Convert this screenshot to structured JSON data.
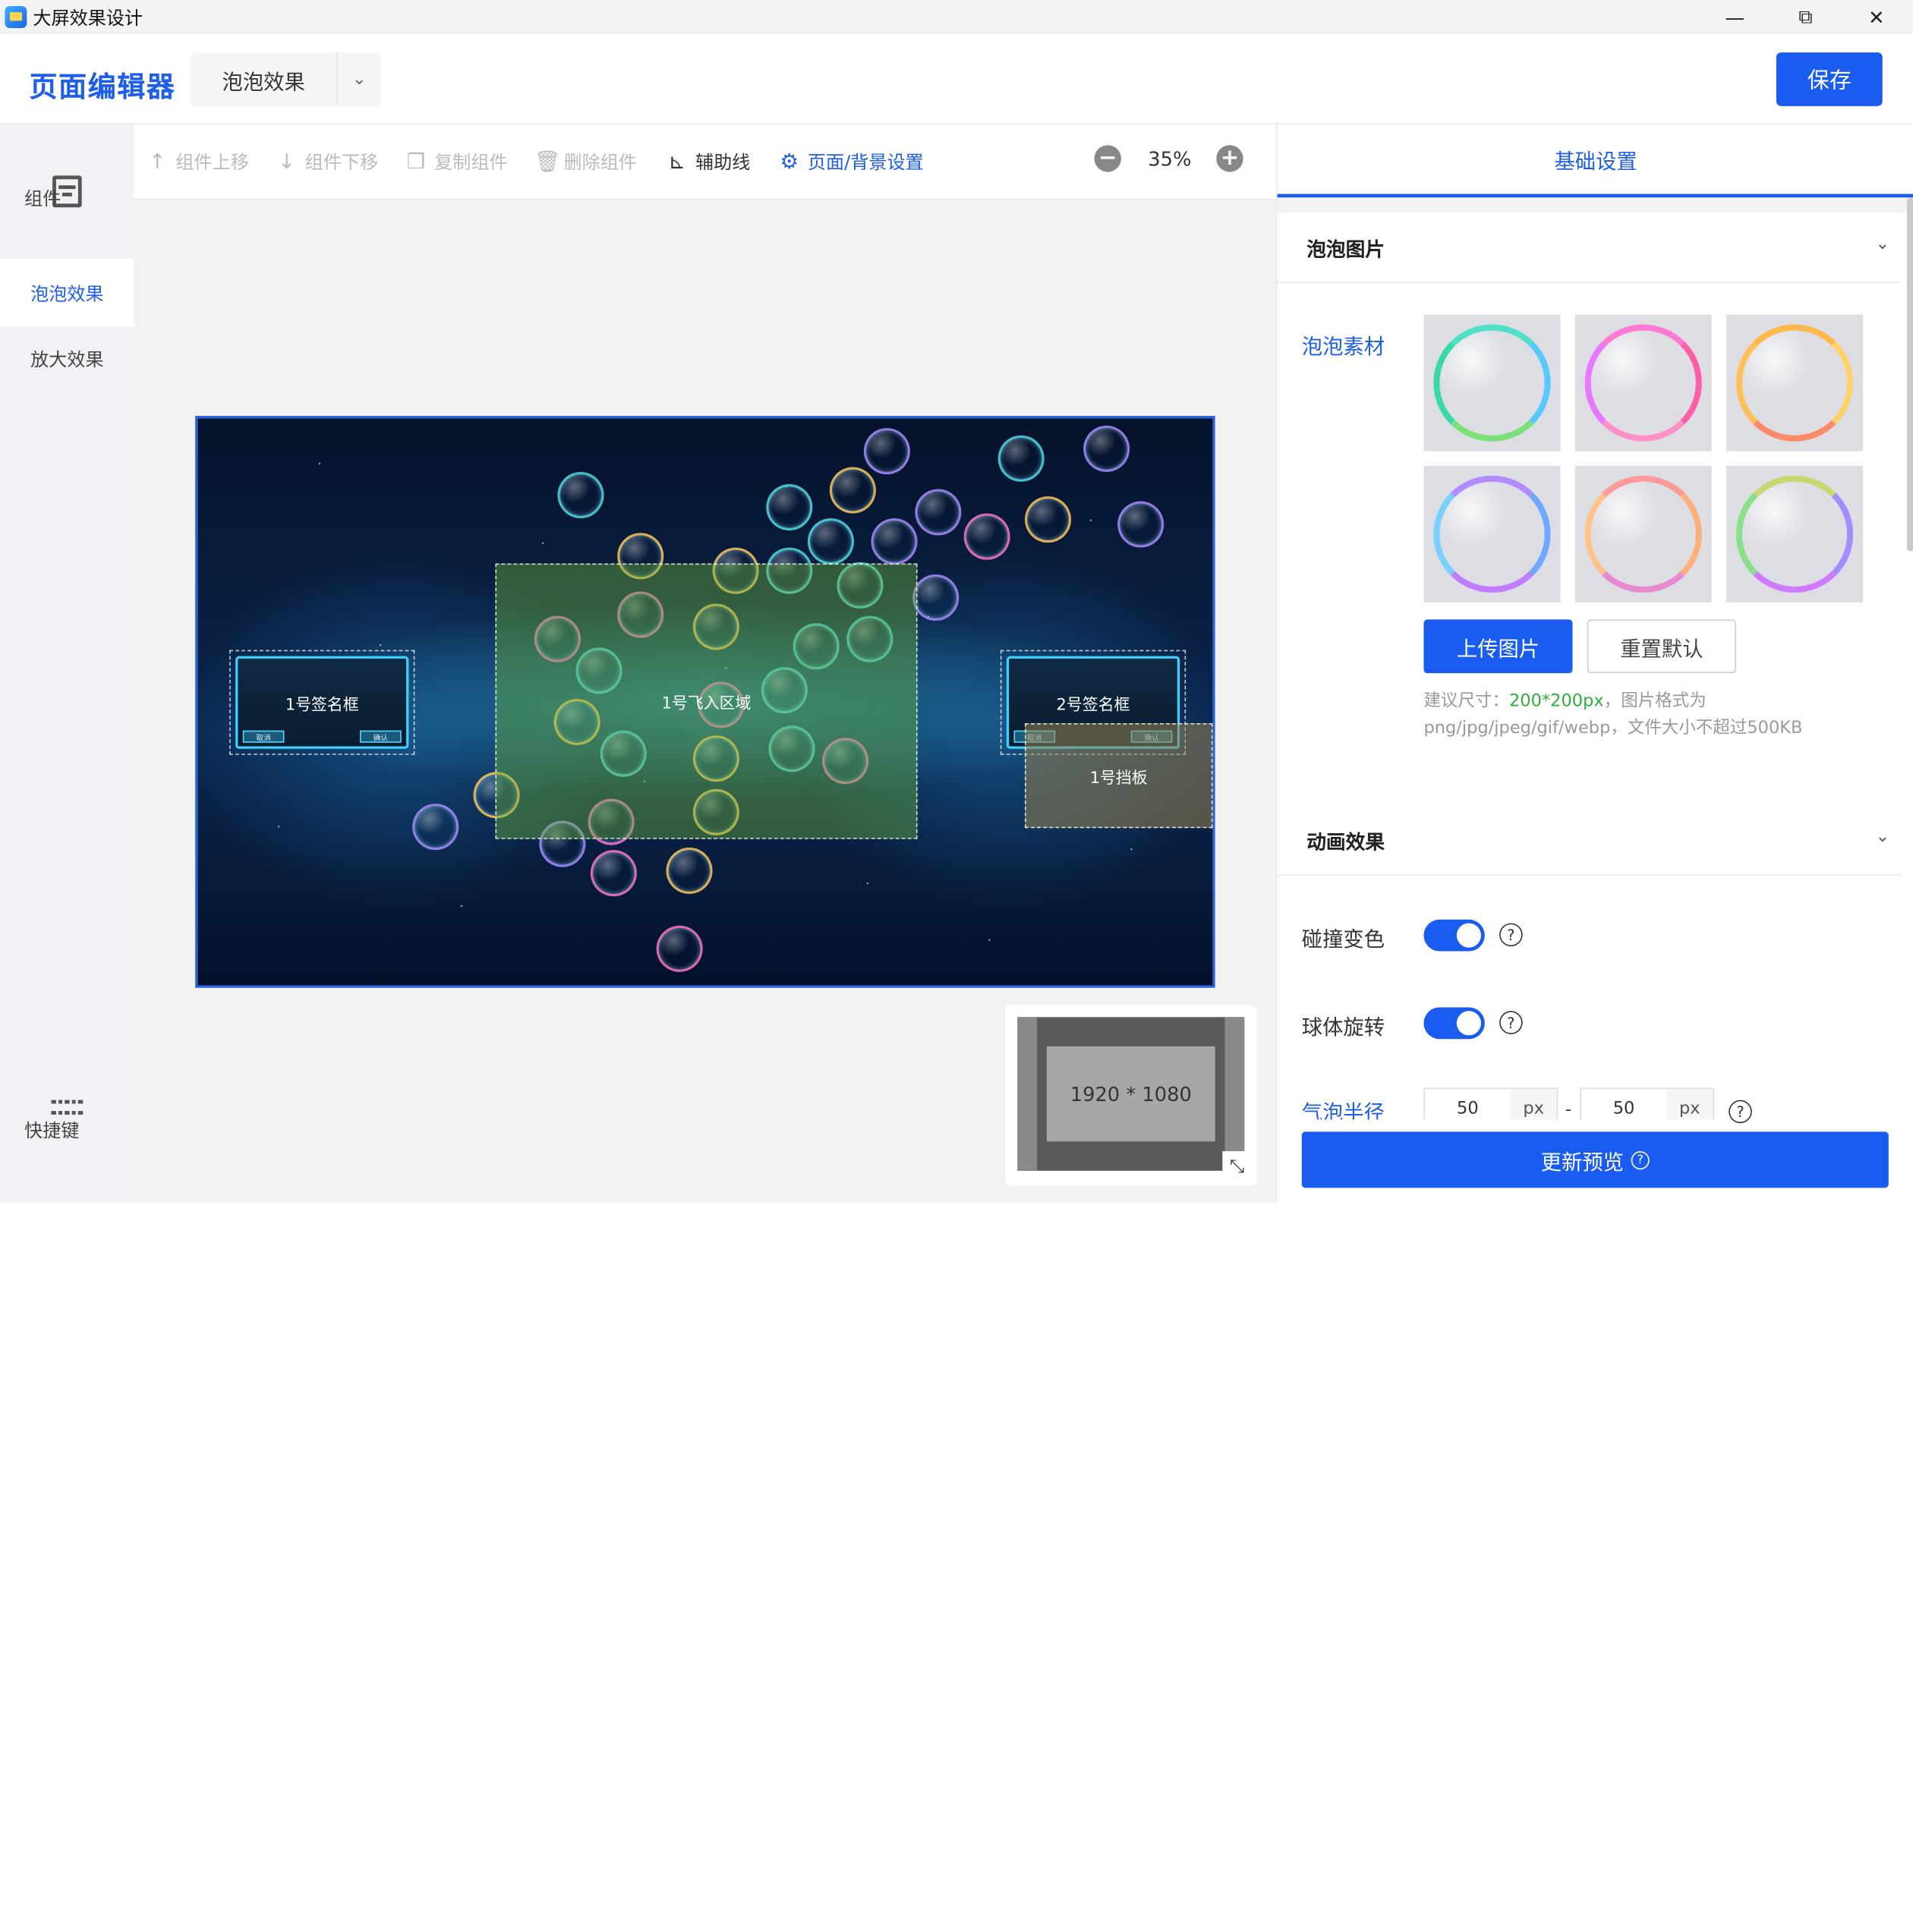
{
  "window": {
    "title": "大屏效果设计",
    "min_glyph": "—",
    "max_glyph": "⧉",
    "close_glyph": "✕"
  },
  "header": {
    "brand": "页面编辑器",
    "selected_page": "泡泡效果",
    "save_label": "保存"
  },
  "sidebar": {
    "components_label": "组件",
    "items": [
      {
        "label": "泡泡效果",
        "active": true
      },
      {
        "label": "放大效果",
        "active": false
      }
    ],
    "shortcuts_label": "快捷键"
  },
  "toolbar": {
    "move_up": "组件上移",
    "move_down": "组件下移",
    "copy": "复制组件",
    "delete": "删除组件",
    "guides": "辅助线",
    "page_bg": "页面/背景设置",
    "zoom": "35%"
  },
  "stage": {
    "fly_zone_label": "1号飞入区域",
    "sign_box_1_label": "1号签名框",
    "sign_box_2_label": "2号签名框",
    "baffle_label": "1号挡板",
    "mini_cancel": "取消",
    "mini_confirm": "确认"
  },
  "thumbnail": {
    "resolution": "1920 * 1080"
  },
  "panel": {
    "tab": "基础设置",
    "section_bubble_image": "泡泡图片",
    "bubble_material_label": "泡泡素材",
    "upload_label": "上传图片",
    "reset_label": "重置默认",
    "hint_prefix": "建议尺寸：",
    "hint_size": "200*200px",
    "hint_suffix": "，图片格式为png/jpg/jpeg/gif/webp，文件大小不超过500KB",
    "section_animation": "动画效果",
    "collision_color_label": "碰撞变色",
    "ball_rotate_label": "球体旋转",
    "bubble_radius_label": "气泡半径",
    "radius_min": "50",
    "radius_max": "50",
    "unit": "px",
    "update_preview_label": "更新预览",
    "collision_color_on": true,
    "ball_rotate_on": true
  },
  "colors": {
    "accent": "#1a5cf0",
    "brand": "#1f5ee8"
  }
}
